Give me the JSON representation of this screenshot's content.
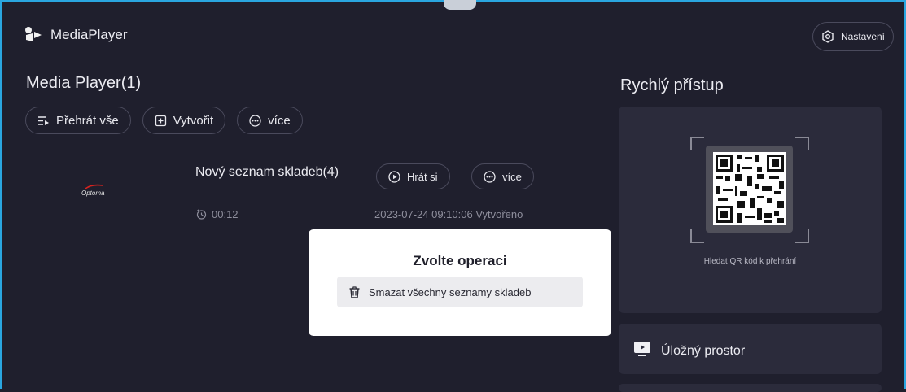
{
  "header": {
    "app_title": "MediaPlayer",
    "settings_label": "Nastavení"
  },
  "main": {
    "title": "Media Player(1)",
    "toolbar": {
      "play_all": "Přehrát vše",
      "create": "Vytvořit",
      "more": "více"
    },
    "playlist": {
      "thumbnail_logo": "Optoma",
      "name": "Nový seznam skladeb(4)",
      "play_label": "Hrát si",
      "more_label": "více",
      "duration": "00:12",
      "created": "2023-07-24 09:10:06 Vytvořeno"
    }
  },
  "quick_access": {
    "title": "Rychlý přístup",
    "qr_caption": "Hledat QR kód k přehrání",
    "storage_label": "Úložný prostor"
  },
  "dialog": {
    "title": "Zvolte operaci",
    "option_delete": "Smazat všechny seznamy skladeb"
  },
  "colors": {
    "background": "#1f1f2d",
    "card": "#2b2b3b",
    "accent_border": "#2aa6e0",
    "dialog_bg": "#ffffff"
  },
  "icons": [
    "app-logo-icon",
    "settings-icon",
    "play-all-icon",
    "create-icon",
    "more-icon",
    "play-icon",
    "clock-icon",
    "qr-code-icon",
    "storage-icon",
    "trash-icon"
  ]
}
